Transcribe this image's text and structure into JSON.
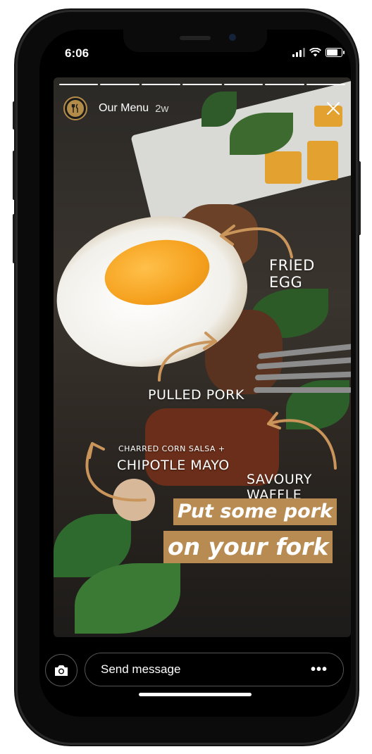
{
  "status_bar": {
    "time": "6:06",
    "signal_bars": 3,
    "battery_level": 0.8
  },
  "story": {
    "account_name": "Our Menu",
    "posted_ago": "2w",
    "progress_segments": 7,
    "current_segment": 7,
    "annotations": {
      "fried_egg": "FRIED EGG",
      "pulled_pork": "PULLED PORK",
      "corn_salsa": "CHARRED CORN SALSA +",
      "chipotle_mayo": "CHIPOTLE MAYO",
      "savoury_waffle": "SAVOURY WAFFLE"
    },
    "promo_line_1": "Put some pork",
    "promo_line_2": "on your fork"
  },
  "footer": {
    "message_placeholder": "Send message",
    "more_label": "•••",
    "camera_icon": "camera-icon"
  },
  "colors": {
    "accent": "#b88b52"
  }
}
